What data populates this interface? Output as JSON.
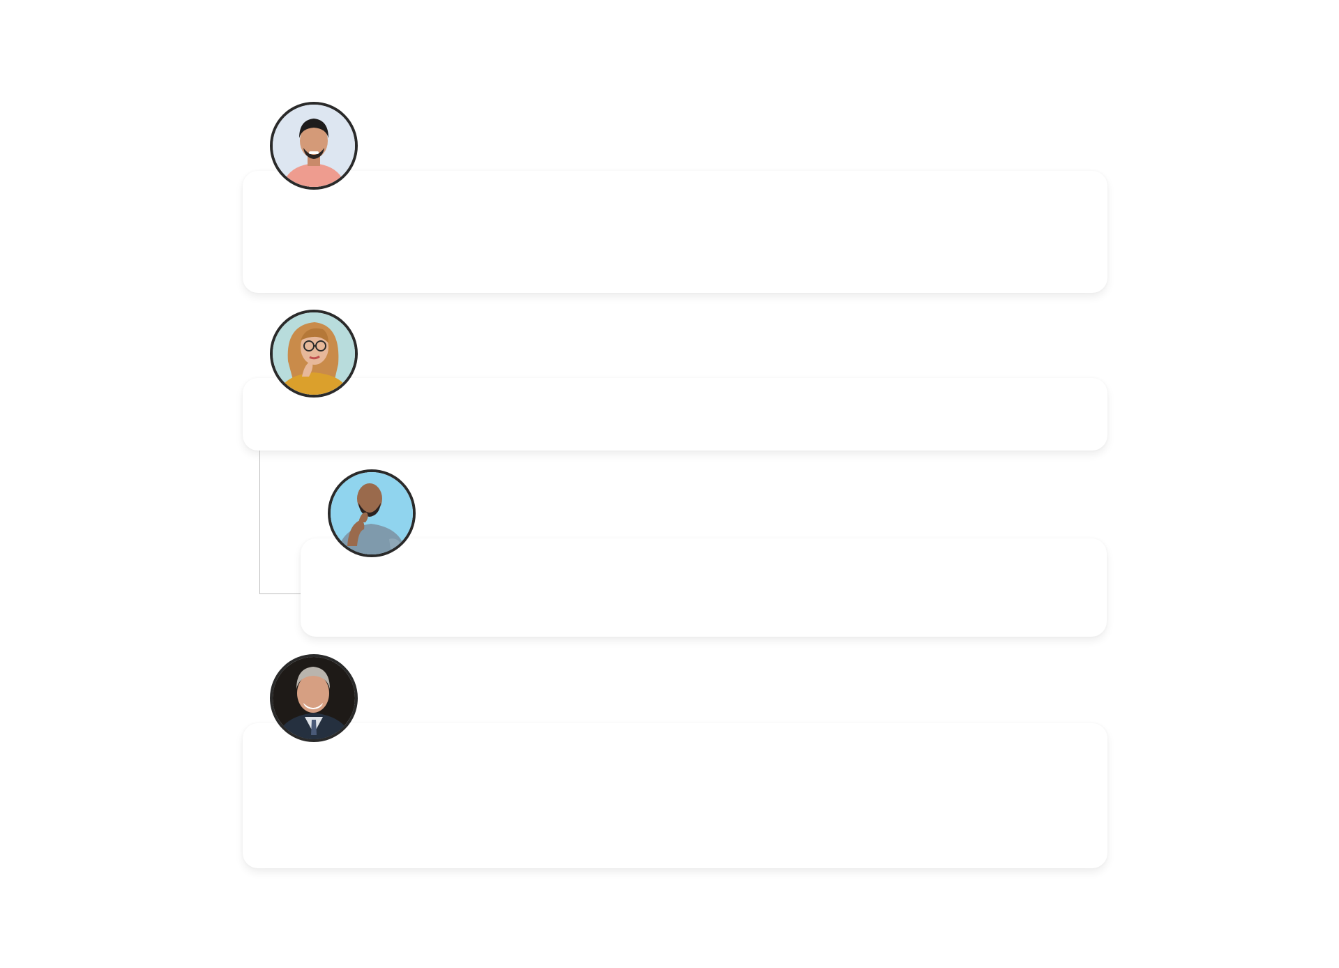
{
  "comments": [
    {
      "avatar": "man-pink-shirt-avatar",
      "background": "#dfe7f2",
      "body": ""
    },
    {
      "avatar": "woman-glasses-avatar",
      "background": "#b9dede",
      "body": ""
    },
    {
      "avatar": "man-thinking-avatar",
      "background": "#8fd4ee",
      "body": "",
      "reply": true
    },
    {
      "avatar": "man-suit-avatar",
      "background": "#1e1a17",
      "body": ""
    }
  ]
}
